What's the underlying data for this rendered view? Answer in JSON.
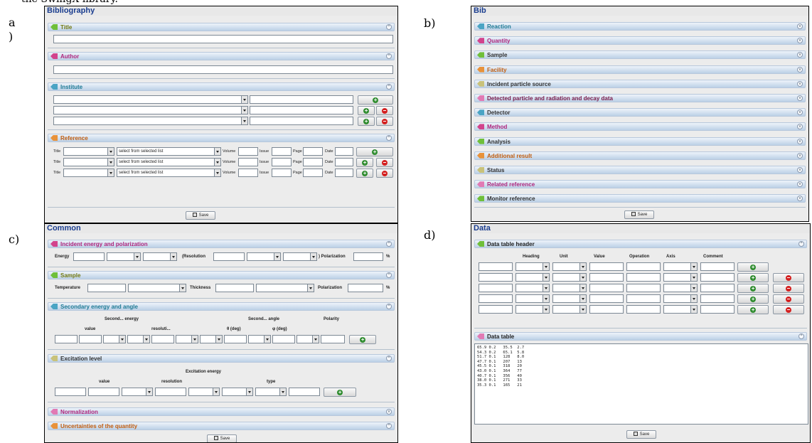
{
  "labels": {
    "a": "a\n)",
    "b": "b)",
    "c": "c)",
    "d": "d)"
  },
  "top_cut": "the SwingX library.",
  "save_label": "Save",
  "colors": {
    "teal": "#1d7a95",
    "magenta": "#b0277e",
    "orange": "#c25e10",
    "olive": "#737a12",
    "blue": "#1a3d8f"
  },
  "a": {
    "title": "Bibliography",
    "sections": {
      "title": "Title",
      "author": "Author",
      "institute": "Institute",
      "reference": "Reference"
    },
    "ref_fields": {
      "title": "Title",
      "select": "select from selected list",
      "volume": "Volume",
      "issue": "Issue",
      "page": "Page",
      "date": "Date"
    }
  },
  "b": {
    "title": "Bib",
    "sections": [
      "Reaction",
      "Quantity",
      "Sample",
      "Facility",
      "Incident particle source",
      "Detected particle and radiation and decay data",
      "Detector",
      "Method",
      "Analysis",
      "Additional result",
      "Status",
      "Related reference",
      "Monitor reference"
    ]
  },
  "c": {
    "title": "Common",
    "s1": "Incident energy and polarization",
    "energy": "Energy",
    "resolution_open": "(Resolution",
    "polarization_close": ") Polarization",
    "pct": "%",
    "s2": "Sample",
    "temperature": "Temperature",
    "thickness": "Thickness",
    "polarization": "Polarization",
    "s3": "Secondary energy and angle",
    "second_energy": "Second... energy",
    "second_angle": "Second... angle",
    "polarity": "Polarity",
    "value": "value",
    "resoluti": "resoluti...",
    "theta": "θ (deg)",
    "phi": "φ (deg)",
    "s4": "Excitation level",
    "exc_energy": "Excitation energy",
    "resolution": "resolution",
    "type": "type",
    "s5": "Normalization",
    "s6": "Uncertainties of the quantity"
  },
  "d": {
    "title": "Data",
    "s1": "Data table header",
    "headers": [
      "Heading",
      "Unit",
      "Value",
      "Operation",
      "Axis",
      "Comment"
    ],
    "s2": "Data table",
    "rows": [
      "65.9 0.2   35.5  2.7",
      "54.3 0.2   65.1  5.8",
      "51.7 0.1   128   8.0",
      "47.7 0.1   207   13",
      "45.5 0.1   318   20",
      "43.0 0.1   364   77",
      "40.7 0.1   356   40",
      "38.0 0.1   271   33",
      "35.3 0.1   165   21"
    ]
  }
}
